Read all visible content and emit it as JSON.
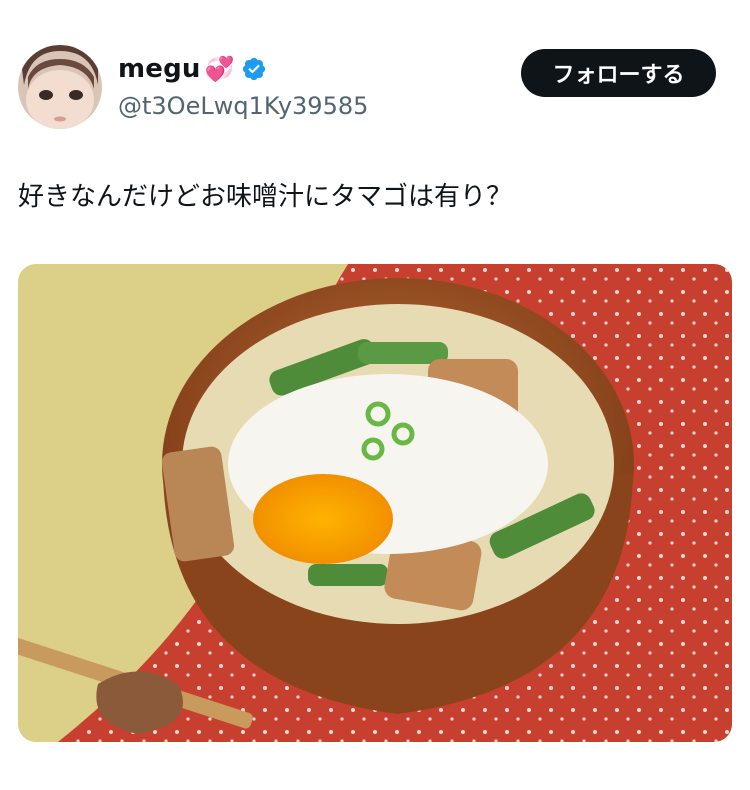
{
  "user": {
    "display_name": "megu",
    "emoji": "💞",
    "handle": "@t3OeLwq1Ky39585",
    "verified_icon": "verified-badge-icon",
    "avatar_icon": "avatar"
  },
  "follow_button": {
    "label": "フォローする"
  },
  "tweet": {
    "text": "好きなんだけどお味噌汁にタマゴは有り？"
  },
  "media": {
    "description_icon": "miso-soup-photo",
    "colors": {
      "background_left": "#d9cf86",
      "cloth": "#c4392b",
      "bowl": "#9a4f22"
    }
  }
}
